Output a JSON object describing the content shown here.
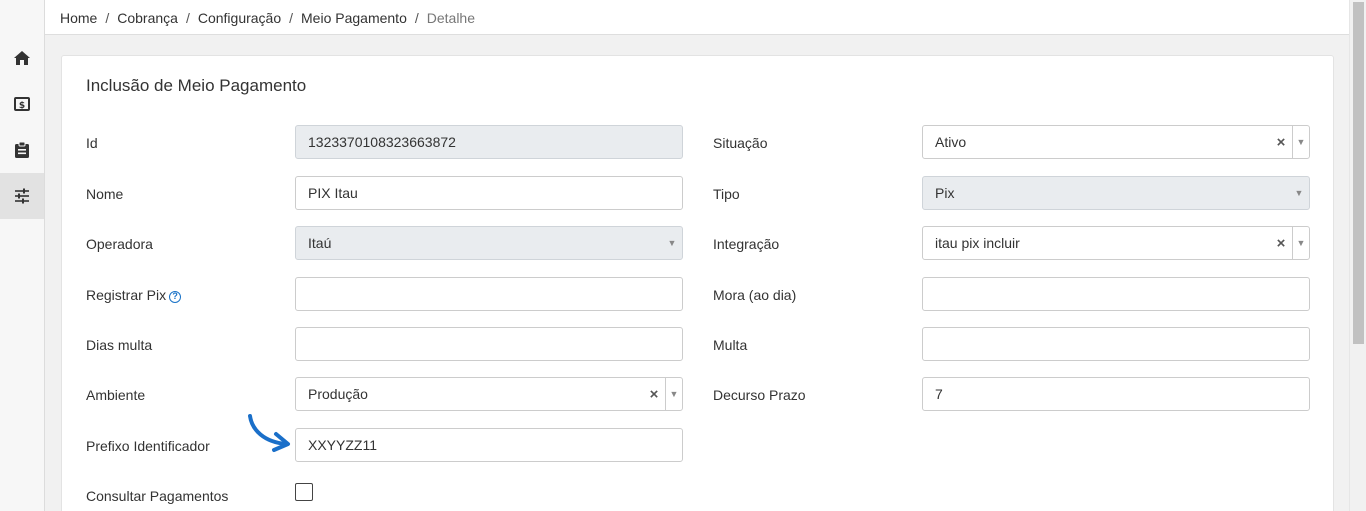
{
  "breadcrumb": {
    "items": [
      "Home",
      "Cobrança",
      "Configuração",
      "Meio Pagamento"
    ],
    "current": "Detalhe",
    "separator": "/"
  },
  "sidebar": {
    "icons": [
      "home-icon",
      "money-icon",
      "clipboard-icon",
      "sliders-icon"
    ],
    "active": "sliders-icon"
  },
  "form": {
    "title": "Inclusão de Meio Pagamento",
    "id": {
      "label": "Id",
      "value": "1323370108323663872"
    },
    "nome": {
      "label": "Nome",
      "value": "PIX Itau"
    },
    "operadora": {
      "label": "Operadora",
      "value": "Itaú"
    },
    "registrar_pix": {
      "label": "Registrar Pix",
      "value": "",
      "help": "?"
    },
    "dias_multa": {
      "label": "Dias multa",
      "value": ""
    },
    "ambiente": {
      "label": "Ambiente",
      "value": "Produção"
    },
    "prefixo": {
      "label": "Prefixo Identificador",
      "value": "XXYYZZ11"
    },
    "consultar": {
      "label": "Consultar Pagamentos",
      "checked": false
    },
    "situacao": {
      "label": "Situação",
      "value": "Ativo"
    },
    "tipo": {
      "label": "Tipo",
      "value": "Pix"
    },
    "integracao": {
      "label": "Integração",
      "value": "itau pix incluir"
    },
    "mora": {
      "label": "Mora (ao dia)",
      "value": ""
    },
    "multa": {
      "label": "Multa",
      "value": ""
    },
    "decurso": {
      "label": "Decurso Prazo",
      "value": "7"
    },
    "clear_glyph": "×",
    "arrow_glyph": "▼"
  },
  "colors": {
    "accent": "#1a73c8",
    "disabled_bg": "#e9ecef",
    "annotation_arrow": "#1a6fc9"
  }
}
